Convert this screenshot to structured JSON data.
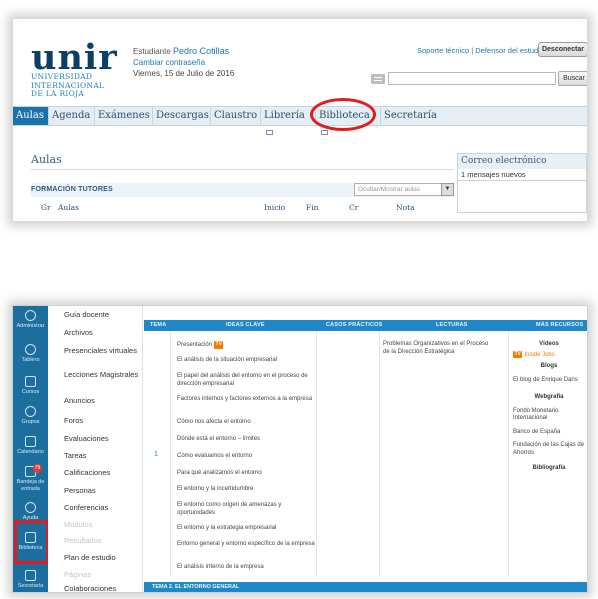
{
  "header": {
    "logo_word": "unir",
    "logo_sub": [
      "UNIVERSIDAD",
      "INTERNACIONAL",
      "DE LA RIOJA"
    ],
    "role_label": "Estudiante",
    "user_name": "Pedro Cotillas",
    "change_password": "Cambiar contraseña",
    "date": "Viernes, 15 de Julio de 2016",
    "support_link": "Soporte técnico",
    "separator": "|",
    "defender_link": "Defensor del estudiante",
    "disconnect_label": "Desconectar",
    "search_placeholder": "",
    "search_button": "Buscar"
  },
  "nav": {
    "tabs": [
      "Aulas",
      "Agenda",
      "Exámenes",
      "Descargas",
      "Claustro",
      "Librería",
      "Biblioteca",
      "Secretaría"
    ],
    "active": "Aulas",
    "highlight_color": "#e21c1c"
  },
  "aulas": {
    "heading": "Aulas",
    "section_title": "FORMACIÓN TUTORES",
    "toggle_label": "Ocultar/Mostrar aulas",
    "columns": [
      "Gr",
      "Aulas",
      "Inicio",
      "Fin",
      "Cr",
      "Nota"
    ]
  },
  "correo": {
    "title": "Correo electrónico",
    "messages": "1 mensajes nuevos"
  },
  "rail": {
    "items": [
      {
        "label": "Administrar",
        "icon": "gear-icon"
      },
      {
        "label": "Tablero",
        "icon": "cloud-icon"
      },
      {
        "label": "Cursos",
        "icon": "book-icon"
      },
      {
        "label": "Grupos",
        "icon": "people-icon"
      },
      {
        "label": "Calendario",
        "icon": "calendar-icon"
      },
      {
        "label": "Bandeja de entrada",
        "icon": "inbox-icon",
        "badge": "79"
      },
      {
        "label": "Ayuda",
        "icon": "help-icon"
      },
      {
        "label": "Biblioteca",
        "icon": "document-icon"
      },
      {
        "label": "Secretaría",
        "icon": "folder-icon"
      }
    ]
  },
  "course_menu": {
    "items": [
      {
        "label": "Guía docente",
        "dim": false
      },
      {
        "label": "Archivos",
        "dim": false
      },
      {
        "label": "Presenciales virtuales",
        "dim": false
      },
      {
        "label": "Lecciones Magistrales",
        "dim": false
      },
      {
        "label": "Anuncios",
        "dim": false
      },
      {
        "label": "Foros",
        "dim": false
      },
      {
        "label": "Evaluaciones",
        "dim": false
      },
      {
        "label": "Tareas",
        "dim": false
      },
      {
        "label": "Calificaciones",
        "dim": false
      },
      {
        "label": "Personas",
        "dim": false
      },
      {
        "label": "Conferencias",
        "dim": false
      },
      {
        "label": "Módulos",
        "dim": true
      },
      {
        "label": "Resultados",
        "dim": true
      },
      {
        "label": "Plan de estudio",
        "dim": false
      },
      {
        "label": "Páginas",
        "dim": true
      },
      {
        "label": "Colaboraciones",
        "dim": false
      }
    ]
  },
  "table": {
    "headers": [
      "TEMA",
      "IDEAS CLAVE",
      "CASOS PRÁCTICOS",
      "LECTURAS",
      "MÁS RECURSOS"
    ],
    "tema_number": "1",
    "ideas": [
      "Presentación",
      "El análisis de la situación empresarial",
      "El papel del análisis del entorno en el proceso de dirección empresarial",
      "Factores internos y factores externos a la empresa",
      "Cómo nos afecta el entorno",
      "Dónde está el entorno – límites",
      "Cómo evaluamos el entorno",
      "Para qué analizamos el entorno",
      "El entorno y la incertidumbre",
      "El entorno como origen de amenazas y oportunidades",
      "El entorno y la estrategia empresarial",
      "Entorno general y entorno específico de la empresa",
      "El análisis interno de la empresa"
    ],
    "tv_badge": "TV",
    "lectura": "Problemas Organizativos en el Proceso de la Dirección Estratégica",
    "recursos": {
      "videos_heading": "Vídeos",
      "video_link": "Inside Jobs",
      "blogs_heading": "Blogs",
      "blog_item": "El blog de Enrique Dans",
      "webgrafia_heading": "Webgrafía",
      "web_items": [
        "Fondo Monetario Internacional",
        "Banco de España",
        "Fundación de las Cajas de Ahorros"
      ],
      "biblio_heading": "Bibliografía"
    },
    "footer": "TEMA 2. EL ENTORNO GENERAL"
  }
}
